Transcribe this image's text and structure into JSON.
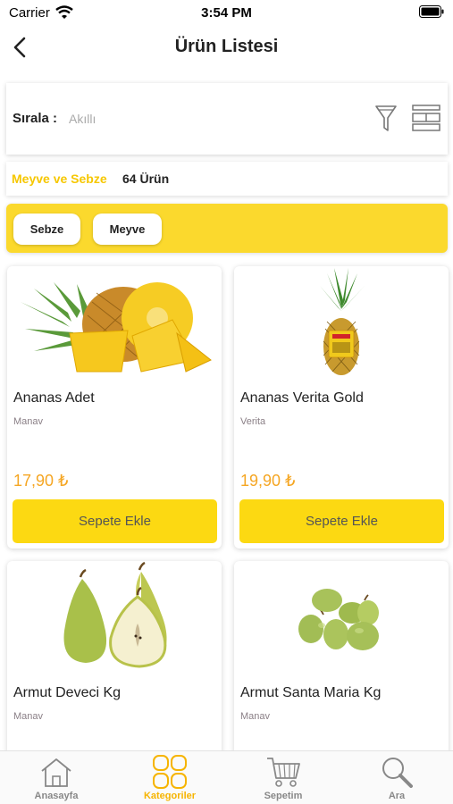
{
  "status_bar": {
    "carrier": "Carrier",
    "time": "3:54 PM"
  },
  "nav": {
    "title": "Ürün Listesi",
    "back_icon": "chevron-left-icon"
  },
  "sort": {
    "label": "Sırala :",
    "value": "Akıllı",
    "filter_icon": "funnel-icon",
    "layout_icon": "grid-layout-icon"
  },
  "category": {
    "name": "Meyve ve Sebze",
    "count": "64 Ürün"
  },
  "chips": [
    {
      "label": "Sebze"
    },
    {
      "label": "Meyve"
    }
  ],
  "products": [
    {
      "name": "Ananas Adet",
      "brand": "Manav",
      "price": "17,90 ₺",
      "button": "Sepete Ekle",
      "image": "pineapple-slices"
    },
    {
      "name": "Ananas Verita Gold",
      "brand": "Verita",
      "price": "19,90 ₺",
      "button": "Sepete Ekle",
      "image": "pineapple-whole"
    },
    {
      "name": "Armut Deveci Kg",
      "brand": "Manav",
      "image": "pears-deveci"
    },
    {
      "name": "Armut Santa Maria Kg",
      "brand": "Manav",
      "image": "pears-santa-maria"
    }
  ],
  "tabs": [
    {
      "label": "Anasayfa",
      "icon": "home-icon",
      "active": false
    },
    {
      "label": "Kategoriler",
      "icon": "grid-icon",
      "active": true
    },
    {
      "label": "Sepetim",
      "icon": "cart-icon",
      "active": false
    },
    {
      "label": "Ara",
      "icon": "search-icon",
      "active": false
    }
  ],
  "colors": {
    "accent_yellow": "#fcd912",
    "price_orange": "#f5a623",
    "category_yellow": "#f6c700",
    "active_tab": "#f6b400"
  }
}
